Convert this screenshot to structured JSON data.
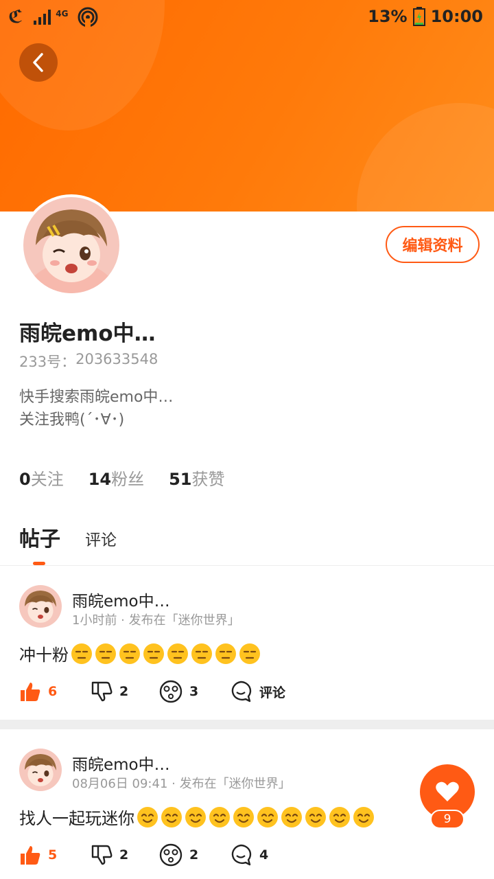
{
  "statusbar": {
    "battery": "13%",
    "time": "10:00",
    "network": "4G"
  },
  "colors": {
    "accent": "#ff5a14",
    "hero": "#ff7a0a"
  },
  "profile": {
    "name": "雨皖emo中…",
    "uid_label": "233号：",
    "uid": "203633548",
    "bio_line1": "快手搜索雨皖emo中…",
    "bio_line2": "关注我鸭(´･∀･)",
    "edit_label": "编辑资料"
  },
  "stats": [
    {
      "value": "0",
      "label": "关注"
    },
    {
      "value": "14",
      "label": "粉丝"
    },
    {
      "value": "51",
      "label": "获赞"
    }
  ],
  "tabs": {
    "posts": "帖子",
    "comments": "评论"
  },
  "posts": [
    {
      "author": "雨皖emo中…",
      "meta": "1小时前 · 发布在「迷你世界」",
      "text": "冲十粉",
      "emoji_count": 8,
      "emoji": "expressionless-face",
      "likes": "6",
      "dislikes": "2",
      "wow": "3",
      "comments": "评论"
    },
    {
      "author": "雨皖emo中…",
      "meta": "08月06日 09:41 · 发布在「迷你世界」",
      "text": "找人一起玩迷你",
      "emoji_count": 10,
      "emoji": "smiling-face",
      "likes": "5",
      "dislikes": "2",
      "wow": "2",
      "comments": "4"
    }
  ],
  "fab": {
    "count": "9"
  }
}
